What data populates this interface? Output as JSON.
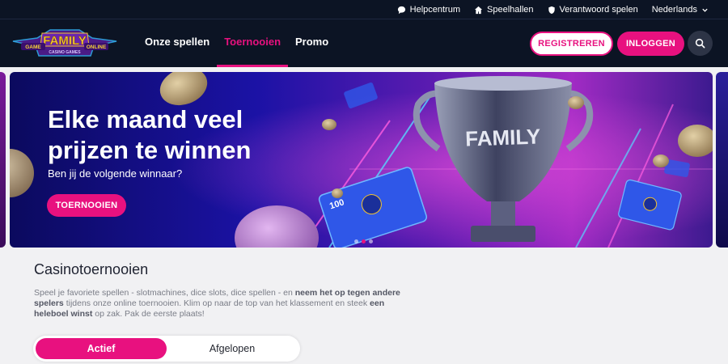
{
  "topbar": {
    "help": "Helpcentrum",
    "halls": "Speelhallen",
    "responsible": "Verantwoord spelen",
    "language": "Nederlands"
  },
  "logo": {
    "main": "FAMILY",
    "left": "GAME",
    "right": "ONLINE",
    "bottom": "CASINO GAMES"
  },
  "nav": {
    "items": [
      {
        "label": "Onze spellen"
      },
      {
        "label": "Toernooien"
      },
      {
        "label": "Promo"
      }
    ],
    "active_index": 1,
    "register": "REGISTREREN",
    "login": "INLOGGEN"
  },
  "banner": {
    "title": "Elke maand veel prijzen te winnen",
    "subtitle": "Ben jij de volgende winnaar?",
    "button": "TOERNOOIEN",
    "trophy_text": "FAMILY",
    "card_value": "100",
    "dots": 3,
    "active_dot": 1
  },
  "section": {
    "title": "Casinotoernooien",
    "text_parts": [
      {
        "t": "Speel je favoriete spellen - slotmachines, dice slots, dice spellen - en ",
        "b": false
      },
      {
        "t": "neem het op tegen andere spelers",
        "b": true
      },
      {
        "t": " tijdens onze online toernooien. Klim op naar de top van het klassement en steek ",
        "b": false
      },
      {
        "t": "een heleboel winst",
        "b": true
      },
      {
        "t": " op zak. Pak de eerste plaats!",
        "b": false
      }
    ]
  },
  "tabs": {
    "active": "Actief",
    "past": "Afgelopen"
  },
  "colors": {
    "accent": "#e8117f",
    "navbar": "#0c1424",
    "page": "#f1f1f3"
  },
  "icons": [
    "chat-icon",
    "home-icon",
    "shield-icon",
    "chevron-down-icon",
    "search-icon"
  ]
}
